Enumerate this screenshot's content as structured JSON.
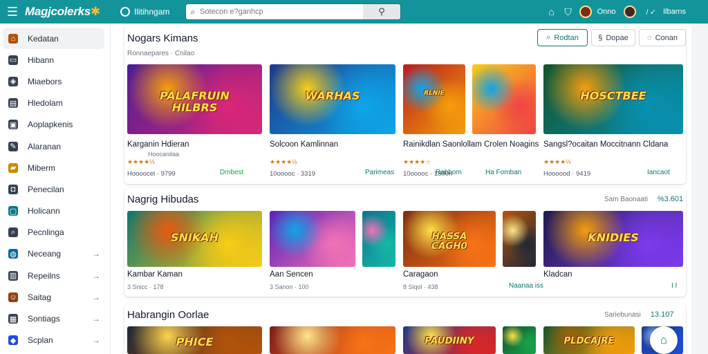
{
  "app": {
    "brand": "Magjcolerks",
    "brand_star": "✱",
    "home_label": "Ilitihngam"
  },
  "search": {
    "placeholder": "Sotecon e?ganhcp",
    "icon": "search-icon"
  },
  "topbar": {
    "user_name": "Onno",
    "separator": "/ ✓",
    "right_label": "Ilbarns"
  },
  "sidebar": {
    "items": [
      {
        "label": "Kedatan",
        "icon": "home-icon",
        "color": "#b45309",
        "active": true
      },
      {
        "label": "Hibann",
        "icon": "tv-icon",
        "color": "#374151"
      },
      {
        "label": "Miaebors",
        "icon": "gamepad-icon",
        "color": "#374151"
      },
      {
        "label": "Hledolam",
        "icon": "book-icon",
        "color": "#374151"
      },
      {
        "label": "Aoplapkenis",
        "icon": "tag-icon",
        "color": "#374151"
      },
      {
        "label": "Alaranan",
        "icon": "pen-icon",
        "color": "#374151"
      },
      {
        "label": "Miberm",
        "icon": "folder-icon",
        "color": "#ca8a04"
      },
      {
        "label": "Penecilan",
        "icon": "bag-icon",
        "color": "#374151"
      },
      {
        "label": "Holicann",
        "icon": "monitor-icon",
        "color": "#0e7490"
      },
      {
        "label": "Pecnlinga",
        "icon": "magnifier-icon",
        "color": "#374151"
      },
      {
        "label": "Neceang",
        "icon": "globe-icon",
        "color": "#0369a1",
        "chevron": true
      },
      {
        "label": "Repeilns",
        "icon": "chart-icon",
        "color": "#374151",
        "chevron": true
      },
      {
        "label": "Saitag",
        "icon": "person-icon",
        "color": "#92400e",
        "chevron": true
      },
      {
        "label": "Sontiags",
        "icon": "grid-icon",
        "color": "#374151",
        "chevron": true
      },
      {
        "label": "Scplan",
        "icon": "cube-icon",
        "color": "#1d4ed8",
        "chevron": true
      }
    ],
    "chevron": "→"
  },
  "filters": [
    {
      "label": "Rodtan",
      "icon": "search-icon"
    },
    {
      "label": "Dopae",
      "icon": "filter-icon"
    },
    {
      "label": "Conan",
      "icon": "list-icon"
    }
  ],
  "sections": [
    {
      "title": "Nogars Kimans",
      "subtitle": "Ronnaepares · Cnilao",
      "cards": [
        {
          "title": "Karganin Hdieran",
          "subtitle": "Hoocanilaa",
          "stars": "★★★★½",
          "info": "Hoooocel · 9799",
          "dl": "Dmbest",
          "colors": [
            "#4c1d95",
            "#db2777",
            "#f59e0b"
          ],
          "art": "PALAFRUIN\nHILBRS"
        },
        {
          "title": "Solcoon Kamlinnan",
          "subtitle": "",
          "stars": "★★★★½",
          "info": "10ooooc · 3319",
          "dl": "Parimeas",
          "colors": [
            "#1e3a8a",
            "#0ea5e9",
            "#facc15"
          ],
          "art": "WARHAS"
        },
        {
          "title": "Rainikdlan Saonlollam Crolen Noagins",
          "subtitle": "",
          "stars": "★★★★☆",
          "info": "10ooooc · 1800n",
          "dl": "Rabbom",
          "colors": [
            "#b91c1c",
            "#f59e0b",
            "#0ea5e9"
          ],
          "art": "RLNIE"
        },
        {
          "title": "Sangsl?ocaitan Moccitnann Cldana",
          "subtitle": "",
          "stars": "★★★★½",
          "info": "Hoooood · 9419",
          "dl": "Iancaot",
          "colors": [
            "#14532d",
            "#0891b2",
            "#f59e0b"
          ],
          "art": "HOSCTBEE"
        }
      ],
      "card_dl_extra": "Ha Fomban"
    },
    {
      "title": "Nagrig Hibudas",
      "meta_left": "Sam Baonaati",
      "meta_right": "%3.601",
      "cards": [
        {
          "title": "Kambar Kaman",
          "stars": "3 Snicc · 178",
          "colors": [
            "#0f766e",
            "#facc15",
            "#ea580c"
          ],
          "art": "SNIKAH"
        },
        {
          "title": "Aan Sencen",
          "stars": "3 Sanon · 100",
          "colors": [
            "#5b21b6",
            "#f472b6",
            "#0ea5e9"
          ],
          "art": ""
        },
        {
          "title": "Caragaon",
          "stars": "8 Siqol · 438",
          "extra": "Naanaa  iss",
          "colors": [
            "#7c2d12",
            "#f97316",
            "#fde047"
          ],
          "art": "HASSA\nCAGH0"
        },
        {
          "title": "Kladcan",
          "stars": "",
          "extra": "I I",
          "colors": [
            "#1e1b4b",
            "#7c3aed",
            "#f59e0b"
          ],
          "art": "KNIDIES"
        }
      ]
    },
    {
      "title": "Habrangin Oorlae",
      "meta_left": "Sariebunasi",
      "meta_right": "13.107",
      "cards": [
        {
          "colors": [
            "#1f2937",
            "#b45309",
            "#fcd34d"
          ],
          "art": "PHICE"
        },
        {
          "colors": [
            "#7f1d1d",
            "#f97316",
            "#fde68a"
          ],
          "art": ""
        },
        {
          "colors": [
            "#1e3a8a",
            "#dc2626",
            "#fde047"
          ],
          "art": "PAUDIINY"
        },
        {
          "colors": [
            "#14532d",
            "#f59e0b",
            "#a16207"
          ],
          "art": "PLDCAJRE"
        }
      ]
    }
  ],
  "fab_icon": "home-icon"
}
